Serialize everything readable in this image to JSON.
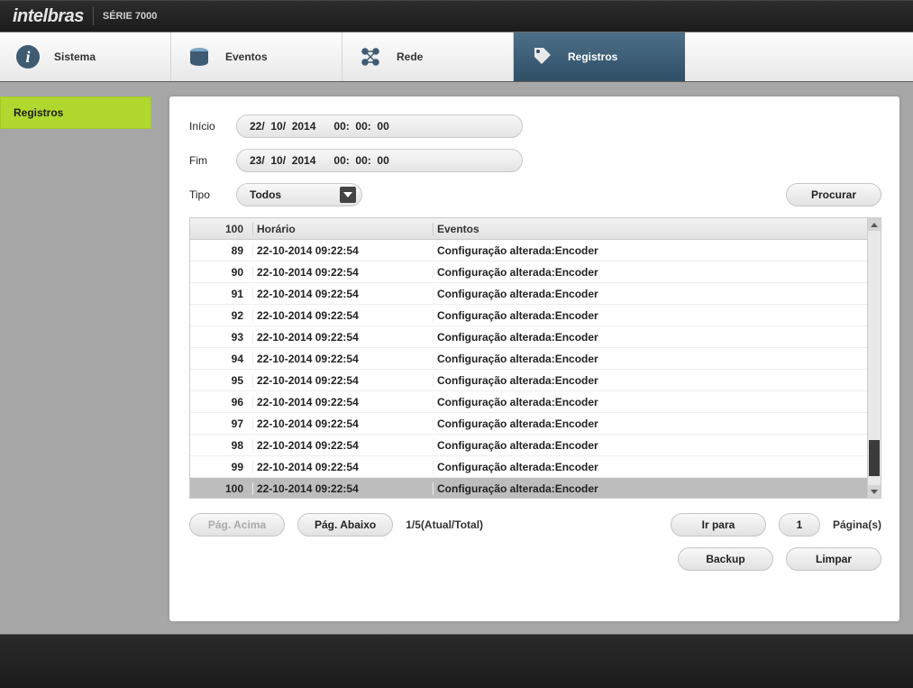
{
  "header": {
    "brand": "intelbras",
    "serie": "SÉRIE 7000"
  },
  "nav": {
    "items": [
      {
        "label": "Sistema",
        "icon": "info-icon"
      },
      {
        "label": "Eventos",
        "icon": "cylinder-icon"
      },
      {
        "label": "Rede",
        "icon": "network-icon"
      },
      {
        "label": "Registros",
        "icon": "tag-icon",
        "active": true
      }
    ]
  },
  "sidebar": {
    "items": [
      {
        "label": "Registros"
      }
    ]
  },
  "form": {
    "start_label": "Início",
    "end_label": "Fim",
    "type_label": "Tipo",
    "start_value": "22/  10/  2014      00:  00:  00",
    "end_value": "23/  10/  2014      00:  00:  00",
    "type_selected": "Todos",
    "search_btn": "Procurar"
  },
  "table": {
    "col1": "100",
    "col2": "Horário",
    "col3": "Eventos",
    "rows": [
      {
        "n": "89",
        "time": "22-10-2014 09:22:54",
        "event": "Configuração alterada:Encoder"
      },
      {
        "n": "90",
        "time": "22-10-2014 09:22:54",
        "event": "Configuração alterada:Encoder"
      },
      {
        "n": "91",
        "time": "22-10-2014 09:22:54",
        "event": "Configuração alterada:Encoder"
      },
      {
        "n": "92",
        "time": "22-10-2014 09:22:54",
        "event": "Configuração alterada:Encoder"
      },
      {
        "n": "93",
        "time": "22-10-2014 09:22:54",
        "event": "Configuração alterada:Encoder"
      },
      {
        "n": "94",
        "time": "22-10-2014 09:22:54",
        "event": "Configuração alterada:Encoder"
      },
      {
        "n": "95",
        "time": "22-10-2014 09:22:54",
        "event": "Configuração alterada:Encoder"
      },
      {
        "n": "96",
        "time": "22-10-2014 09:22:54",
        "event": "Configuração alterada:Encoder"
      },
      {
        "n": "97",
        "time": "22-10-2014 09:22:54",
        "event": "Configuração alterada:Encoder"
      },
      {
        "n": "98",
        "time": "22-10-2014 09:22:54",
        "event": "Configuração alterada:Encoder"
      },
      {
        "n": "99",
        "time": "22-10-2014 09:22:54",
        "event": "Configuração alterada:Encoder"
      },
      {
        "n": "100",
        "time": "22-10-2014 09:22:54",
        "event": "Configuração alterada:Encoder",
        "selected": true
      }
    ]
  },
  "pager": {
    "prev": "Pág. Acima",
    "next": "Pág. Abaixo",
    "info": "1/5(Atual/Total)",
    "goto": "Ir para",
    "page_value": "1",
    "pages_label": "Página(s)",
    "backup": "Backup",
    "clear": "Limpar"
  }
}
